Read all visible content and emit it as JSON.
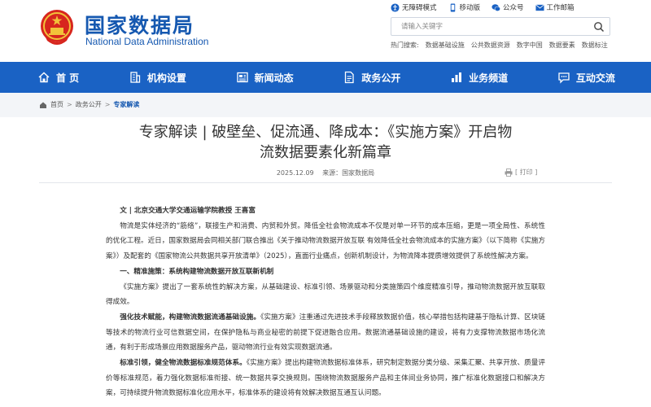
{
  "header": {
    "site_title": "国家数据局",
    "site_subtitle": "National Data Administration",
    "util_links": [
      {
        "label": "无障碍模式",
        "icon": "accessibility-icon"
      },
      {
        "label": "移动版",
        "icon": "mobile-icon"
      },
      {
        "label": "公众号",
        "icon": "wechat-icon"
      },
      {
        "label": "工作邮箱",
        "icon": "mail-icon"
      }
    ],
    "search": {
      "placeholder": "请输入关键字"
    },
    "hot_search_label": "热门搜索:",
    "hot_search_items": [
      "数据基础设施",
      "公共数据资源",
      "数字中国",
      "数据要素",
      "数据标注"
    ]
  },
  "nav": {
    "items": [
      {
        "label": "首 页",
        "icon": "home-icon"
      },
      {
        "label": "机构设置",
        "icon": "building-icon"
      },
      {
        "label": "新闻动态",
        "icon": "news-icon"
      },
      {
        "label": "政务公开",
        "icon": "document-icon"
      },
      {
        "label": "业务频道",
        "icon": "chart-icon"
      },
      {
        "label": "互动交流",
        "icon": "chat-icon"
      }
    ]
  },
  "breadcrumb": {
    "items": [
      "首页",
      "政务公开"
    ],
    "current": "专家解读",
    "separator": ">"
  },
  "article": {
    "title_line1": "专家解读 | 破壁垒、促流通、降成本：《实施方案》开启物",
    "title_line2": "流数据要素化新篇章",
    "date": "2025.12.09",
    "source": "来源：国家数据局",
    "print_label": "[ 打印 ]",
    "author": "文 | 北京交通大学交通运输学院教授 王喜富",
    "p1": "物流是实体经济的“筋络”，联接生产和消费、内贸和外贸。降低全社会物流成本不仅是对单一环节的成本压缩，更是一项全局性、系统性的优化工程。近日，国家数据局会同相关部门联合推出《关于推动物流数据开放互联 有效降低全社会物流成本的实施方案》（以下简称《实施方案》）及配套的《国家物流公共数据共享开放清单》（2025），直面行业痛点，创新机制设计，为物流降本提质增效提供了系统性解决方案。",
    "h1": "一、精准施策：系统构建物流数据开放互联新机制",
    "p2": "《实施方案》提出了一套系统性的解决方案，从基础建设、标准引领、场景驱动和分类施策四个维度精准引导，推动物流数据开放互联取得成效。",
    "p3_bold": "强化技术赋能，构建物流数据流通基础设施。",
    "p3": "《实施方案》注重通过先进技术手段释放数据价值，核心举措包括构建基于隐私计算、区块链等技术的物流行业可信数据空间，在保护隐私与商业秘密的前提下促进融合应用。数据流通基础设施的建设，将有力支撑物流数据市场化流通，有利于形成场景应用数据服务产品，驱动物流行业有效实现数据流通。",
    "p4_bold": "标准引领，健全物流数据标准规范体系。",
    "p4": "《实施方案》提出构建物流数据标准体系，研究制定数据分类分级、采集汇聚、共享开放、质量评价等标准规范，着力强化数据标准衔接、统一数据共享交换规则。围绕物流数据服务产品和主体间业务协同，推广标准化数据接口和解决方案，可持续提升物流数据标准化应用水平，标准体系的建设将有效解决数据互通互认问题。"
  }
}
